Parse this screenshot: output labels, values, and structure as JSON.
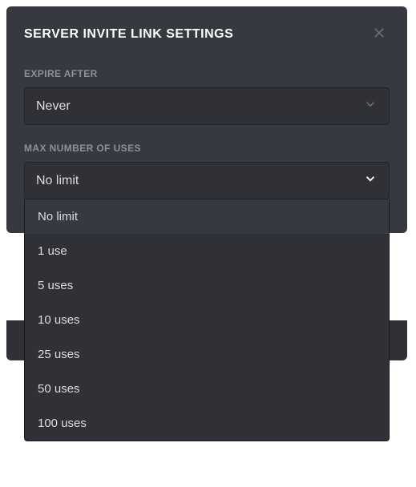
{
  "modal": {
    "title": "SERVER INVITE LINK SETTINGS"
  },
  "expire": {
    "label": "EXPIRE AFTER",
    "selected": "Never"
  },
  "maxUses": {
    "label": "MAX NUMBER OF USES",
    "selected": "No limit",
    "options": [
      "No limit",
      "1 use",
      "5 uses",
      "10 uses",
      "25 uses",
      "50 uses",
      "100 uses"
    ]
  }
}
